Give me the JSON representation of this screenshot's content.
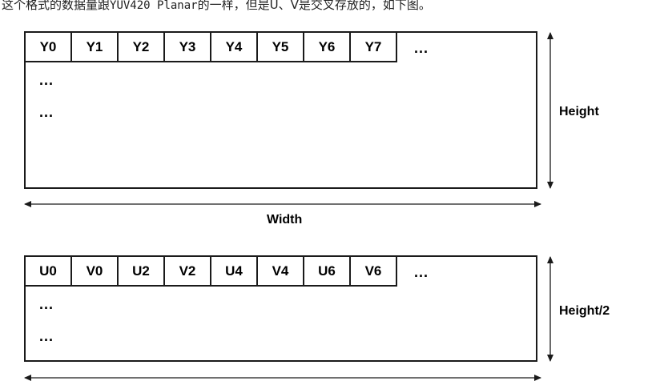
{
  "intro": {
    "before": "这个格式的数据量跟",
    "code": "YUV420 Planar",
    "after": "的一样，但是U、V是交叉存放的，如下图。"
  },
  "y_plane": {
    "cells": [
      "Y0",
      "Y1",
      "Y2",
      "Y3",
      "Y4",
      "Y5",
      "Y6",
      "Y7"
    ],
    "row_ellipsis": "...",
    "col_ellipsis_1": "...",
    "col_ellipsis_2": "...",
    "height_label": "Height",
    "width_label": "Width"
  },
  "uv_plane": {
    "cells": [
      "U0",
      "V0",
      "U2",
      "V2",
      "U4",
      "V4",
      "U6",
      "V6"
    ],
    "row_ellipsis": "...",
    "col_ellipsis_1": "...",
    "col_ellipsis_2": "...",
    "height_label": "Height/2"
  }
}
